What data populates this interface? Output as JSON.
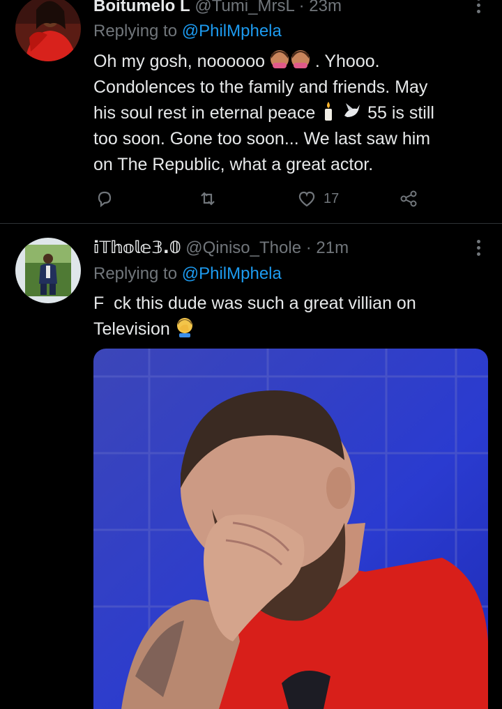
{
  "tweet1": {
    "name": "Boitumelo L",
    "handle": "@Tumi_MrsL",
    "time": "· 23m",
    "replying_prefix": "Replying to",
    "replying_handle": "@PhilMphela",
    "text_line1a": "Oh my gosh, noooooo",
    "text_line1b": ". Yhooo.",
    "text_line2": "Condolences to the family and friends. May",
    "text_line3a": "his soul rest in eternal peace",
    "text_line3b": "55 is still",
    "text_line4": "too soon. Gone too soon... We last saw him",
    "text_line5": "on The Republic, what a great actor.",
    "like_count": "17"
  },
  "tweet2": {
    "name": "𝕚𝕋𝕙𝕠𝕝𝕖𝟛.𝟘",
    "handle": "@Qiniso_Thole",
    "time": "· 21m",
    "replying_prefix": "Replying to",
    "replying_handle": "@PhilMphela",
    "text_line1": "F  ck this dude was such a great villian on",
    "text_line2": "Television"
  },
  "icons": {
    "reply": "reply-icon",
    "retweet": "retweet-icon",
    "like": "heart-icon",
    "share": "share-icon",
    "more": "more-vertical-icon"
  },
  "colors": {
    "background": "#000000",
    "text": "#e7e9ea",
    "muted": "#71767b",
    "link": "#1d9bf0"
  }
}
